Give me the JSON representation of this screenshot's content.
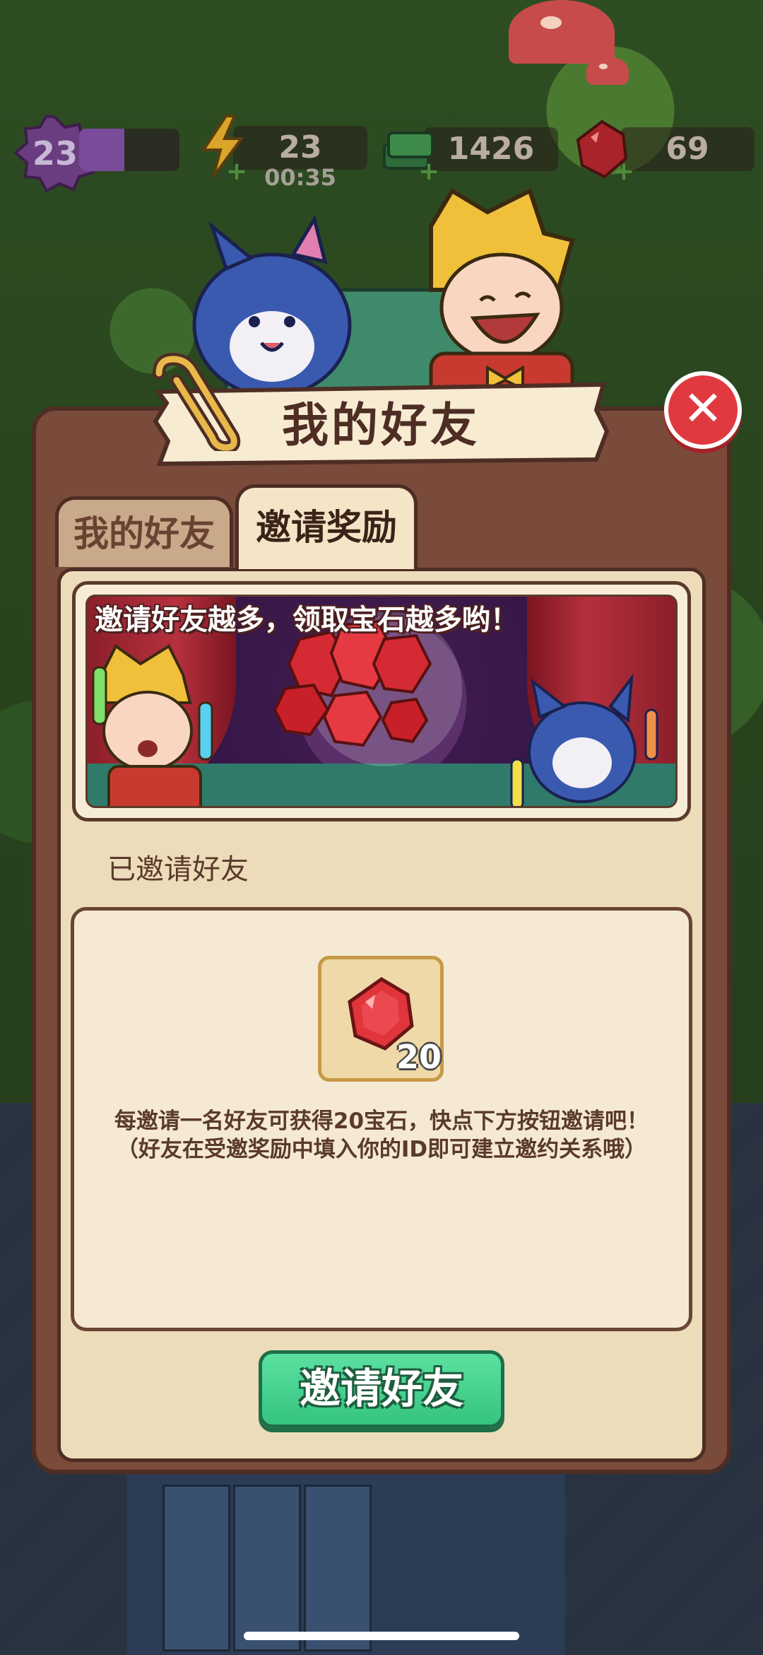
{
  "hud": {
    "level": "23",
    "xp_progress": 0.45,
    "energy": "23",
    "energy_timer": "00:35",
    "cash": "1426",
    "gems": "69"
  },
  "dialog": {
    "title": "我的好友",
    "tabs": [
      {
        "label": "我的好友",
        "active": false
      },
      {
        "label": "邀请奖励",
        "active": true
      }
    ],
    "banner_text": "邀请好友越多，领取宝石越多哟！",
    "section_label": "已邀请好友",
    "reward_count": "20",
    "description_line1": "每邀请一名好友可获得20宝石，快点下方按钮邀请吧！",
    "description_line2": "（好友在受邀奖励中填入你的ID即可建立邀约关系哦）",
    "invite_button": "邀请好友"
  },
  "icons": {
    "level": "level-badge-icon",
    "energy": "lightning-icon",
    "cash": "cash-stack-icon",
    "gem": "red-gem-icon",
    "close": "close-icon"
  },
  "colors": {
    "dialog_frame": "#7a4a3a",
    "dialog_panel": "#eddcba",
    "close_red": "#e0393f",
    "invite_green": "#35c47f",
    "gem_red": "#e0353b"
  }
}
